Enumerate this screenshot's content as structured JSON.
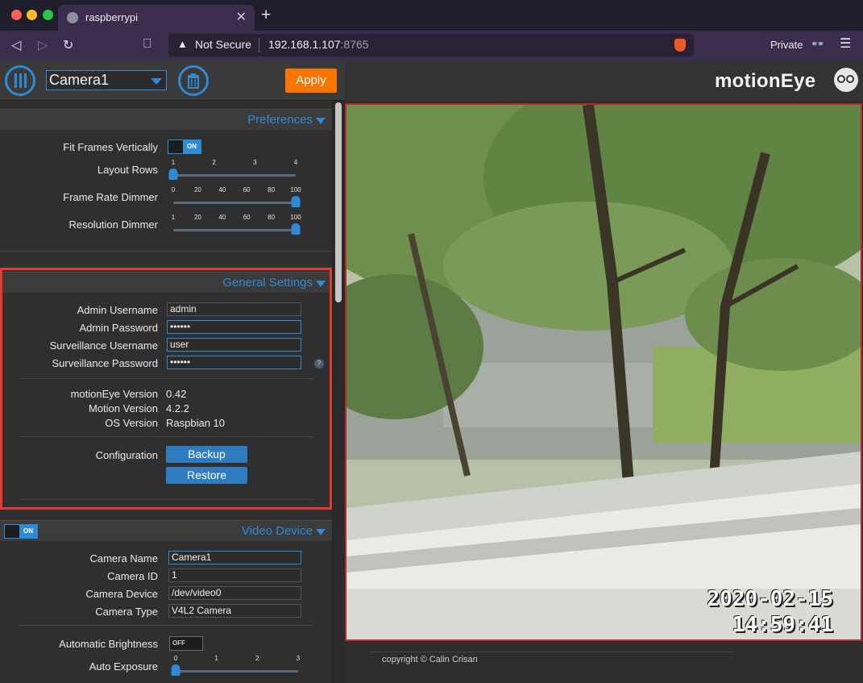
{
  "browser": {
    "tab_title": "raspberrypi",
    "security_label": "Not Secure",
    "url_host": "192.168.1.107",
    "url_port": ":8765",
    "private_label": "Private"
  },
  "topbar": {
    "camera_selected": "Camera1",
    "apply_label": "Apply"
  },
  "preferences": {
    "title": "Preferences",
    "fit_frames_label": "Fit Frames Vertically",
    "fit_frames_toggle": "ON",
    "layout_rows_label": "Layout Rows",
    "layout_rows_ticks": [
      "1",
      "2",
      "3",
      "4"
    ],
    "layout_rows_value": 1,
    "frame_rate_label": "Frame Rate Dimmer",
    "frame_rate_ticks": [
      "0",
      "20",
      "40",
      "60",
      "80",
      "100"
    ],
    "frame_rate_value": 100,
    "resolution_label": "Resolution Dimmer",
    "resolution_ticks": [
      "1",
      "20",
      "40",
      "60",
      "80",
      "100"
    ],
    "resolution_value": 100
  },
  "general": {
    "title": "General Settings",
    "admin_username_label": "Admin Username",
    "admin_username_value": "admin",
    "admin_password_label": "Admin Password",
    "admin_password_value": "••••••",
    "surv_username_label": "Surveillance Username",
    "surv_username_value": "user",
    "surv_password_label": "Surveillance Password",
    "surv_password_value": "••••••",
    "help_glyph": "?",
    "motioneye_version_label": "motionEye Version",
    "motioneye_version_value": "0.42",
    "motion_version_label": "Motion Version",
    "motion_version_value": "4.2.2",
    "os_version_label": "OS Version",
    "os_version_value": "Raspbian 10",
    "configuration_label": "Configuration",
    "backup_label": "Backup",
    "restore_label": "Restore"
  },
  "video_device": {
    "title": "Video Device",
    "toggle": "ON",
    "camera_name_label": "Camera Name",
    "camera_name_value": "Camera1",
    "camera_id_label": "Camera ID",
    "camera_id_value": "1",
    "camera_device_label": "Camera Device",
    "camera_device_value": "/dev/video0",
    "camera_type_label": "Camera Type",
    "camera_type_value": "V4L2 Camera",
    "auto_brightness_label": "Automatic Brightness",
    "auto_brightness_toggle": "OFF",
    "auto_exposure_label": "Auto Exposure",
    "auto_exposure_ticks": [
      "0",
      "1",
      "2",
      "3"
    ],
    "auto_exposure_value": 0
  },
  "camera_view": {
    "logo": "motionEye",
    "date": "2020-02-15",
    "time": "14:59:41",
    "copyright": "copyright © Calin Crisan"
  },
  "colors": {
    "accent": "#2f8ad6",
    "apply": "#f77600",
    "highlight": "#e53935"
  }
}
